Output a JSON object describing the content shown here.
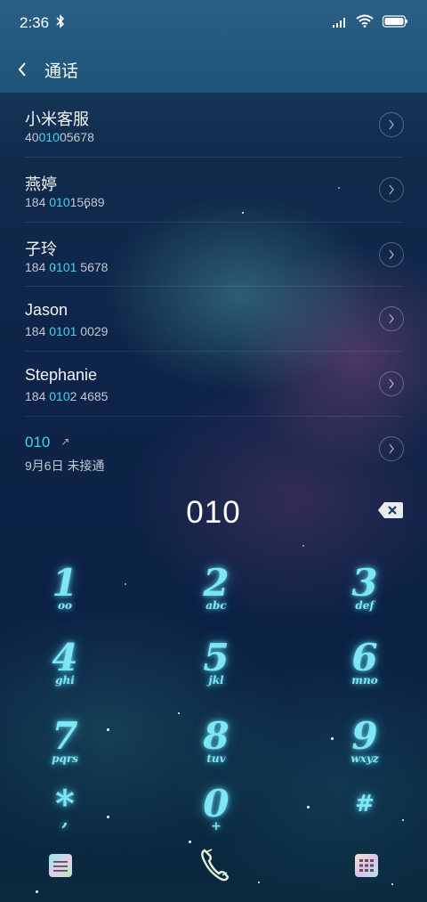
{
  "status_bar": {
    "time": "2:36"
  },
  "header": {
    "title": "通话"
  },
  "calls": [
    {
      "name": "小米客服",
      "number_pre": "40",
      "number_hl": "010",
      "number_post": "05678"
    },
    {
      "name": "燕婷",
      "number_pre": "184 ",
      "number_hl": "010",
      "number_post": "15689"
    },
    {
      "name": "子玲",
      "number_pre": "184 ",
      "number_hl": "0101",
      "number_post": " 5678"
    },
    {
      "name": "Jason",
      "number_pre": "184 ",
      "number_hl": "0101",
      "number_post": " 0029"
    },
    {
      "name": "Stephanie",
      "number_pre": "184 ",
      "number_hl": "010",
      "number_post": "2 4685"
    }
  ],
  "recent_entry": {
    "number": "010",
    "detail": "9月6日 未接通"
  },
  "dial_input": {
    "digits": "010"
  },
  "keypad": [
    {
      "digit": "1",
      "letters": "oo"
    },
    {
      "digit": "2",
      "letters": "abc"
    },
    {
      "digit": "3",
      "letters": "def"
    },
    {
      "digit": "4",
      "letters": "ghi"
    },
    {
      "digit": "5",
      "letters": "jkl"
    },
    {
      "digit": "6",
      "letters": "mno"
    },
    {
      "digit": "7",
      "letters": "pqrs"
    },
    {
      "digit": "8",
      "letters": "tuv"
    },
    {
      "digit": "9",
      "letters": "wxyz"
    },
    {
      "digit": "*",
      "letters": ","
    },
    {
      "digit": "0",
      "letters": "+"
    },
    {
      "digit": "#",
      "letters": ""
    }
  ],
  "colors": {
    "accent": "#3ed6ee",
    "header": "#245a80",
    "key_glow": "#7fe6f3"
  }
}
